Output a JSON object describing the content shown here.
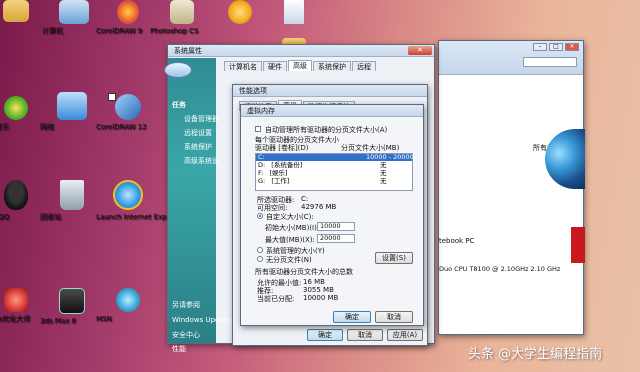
{
  "desktop_icons": [
    {
      "label": "hp",
      "icon": "folder-icon",
      "color": "#e5b84a"
    },
    {
      "label": "计算机",
      "icon": "computer-icon",
      "color": "#7fb3e0"
    },
    {
      "label": "CorelDRAW 9",
      "icon": "coreldraw-balloon-icon",
      "color": "#e95a2a"
    },
    {
      "label": "Photoshop CS",
      "icon": "photoshop-icon",
      "color": "#d9d2b0"
    },
    {
      "label": "",
      "icon": "media-player-icon",
      "color": "#f2a81e"
    },
    {
      "label": "",
      "icon": "document-icon",
      "color": "#dfe6f0"
    },
    {
      "label": "",
      "icon": "folder-icon",
      "color": "#e5b84a"
    },
    {
      "label": "QQ音乐",
      "icon": "qq-music-icon",
      "color": "#5ab82e"
    },
    {
      "label": "网络",
      "icon": "network-icon",
      "color": "#3a8ad8"
    },
    {
      "label": "CorelDRAW 12",
      "icon": "coreldraw-icon",
      "color": "#2a6ab0"
    },
    {
      "label": "腾讯QQ",
      "icon": "qq-penguin-icon",
      "color": "#222222"
    },
    {
      "label": "回收站",
      "icon": "recycle-bin-icon",
      "color": "#b8c4cc"
    },
    {
      "label": "Launch Internet Explorer Browser",
      "icon": "ie-icon",
      "color": "#3aa0e8"
    },
    {
      "label": "dows优化大师",
      "icon": "optimizer-icon",
      "color": "#d83a3a"
    },
    {
      "label": "3ds Max 8",
      "icon": "3dsmax-icon",
      "color": "#2a2a2a"
    },
    {
      "label": "MSN",
      "icon": "msn-icon",
      "color": "#3aa8e0"
    }
  ],
  "system_properties": {
    "title": "系统属性",
    "tabs": [
      "计算机名",
      "硬件",
      "高级",
      "系统保护",
      "远程"
    ],
    "active_tab": 2,
    "sidebar_title": "任务",
    "sidebar_items": [
      "设备管理器",
      "远程设置",
      "系统保护",
      "高级系统设"
    ],
    "bottom_title": "另请参阅",
    "bottom_items": [
      "Windows Update",
      "安全中心",
      "性能"
    ]
  },
  "performance": {
    "title": "性能选项",
    "tabs": [
      "视觉效果",
      "高级",
      "数据执行保护"
    ],
    "ok_label": "确定",
    "cancel_label": "取消",
    "apply_label": "应用(A)"
  },
  "virtual_memory": {
    "title": "虚拟内存",
    "auto_manage_label": "自动管理所有驱动器的分页文件大小(A)",
    "section_label": "每个驱动器的分页文件大小",
    "col_drive": "驱动器 [卷标](D)",
    "col_size": "分页文件大小(MB)",
    "drives": [
      {
        "drive": "C:",
        "label": "",
        "size": "10000 - 20000",
        "selected": true
      },
      {
        "drive": "D:",
        "label": "[系统备份]",
        "size": "无",
        "selected": false
      },
      {
        "drive": "F:",
        "label": "[娱乐]",
        "size": "无",
        "selected": false
      },
      {
        "drive": "G:",
        "label": "[工作]",
        "size": "无",
        "selected": false
      }
    ],
    "selected_drive_label": "所选驱动器:",
    "selected_drive_value": "C:",
    "free_space_label": "可用空间:",
    "free_space_value": "42976 MB",
    "custom_size_label": "自定义大小(C):",
    "initial_size_label": "初始大小(MB)(I):",
    "initial_size_value": "10000",
    "max_size_label": "最大值(MB)(X):",
    "max_size_value": "20000",
    "system_managed_label": "系统管理的大小(Y)",
    "no_paging_label": "无分页文件(N)",
    "set_label": "设置(S)",
    "total_section_label": "所有驱动器分页文件大小的总数",
    "min_allowed_label": "允许的最小值:",
    "min_allowed_value": "16 MB",
    "recommended_label": "推荐:",
    "recommended_value": "3055 MB",
    "current_label": "当前已分配:",
    "current_value": "10000 MB",
    "ok_label": "确定",
    "cancel_label": "取消"
  },
  "explorer": {
    "copyright_text": "所有权利。",
    "model_text": "tebook PC",
    "cpu_text": "Duo CPU   T8100  @ 2.10GHz   2.10 GHz"
  },
  "watermark": "头条 @大学生编程指南"
}
